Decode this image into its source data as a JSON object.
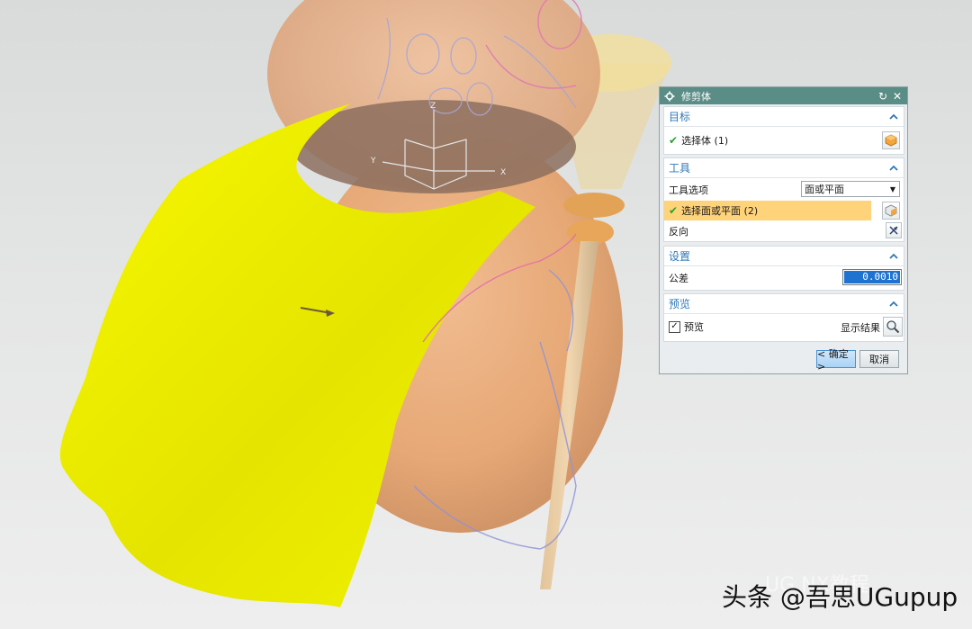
{
  "dialog": {
    "title": "修剪体",
    "target": {
      "header": "目标",
      "select_body": "选择体 (1)"
    },
    "tool": {
      "header": "工具",
      "tool_option_label": "工具选项",
      "tool_option_value": "面或平面",
      "select_face": "选择面或平面 (2)",
      "reverse_label": "反向"
    },
    "settings": {
      "header": "设置",
      "tolerance_label": "公差",
      "tolerance_value": "0.0010"
    },
    "preview": {
      "header": "预览",
      "preview_label": "预览",
      "preview_checked": true,
      "show_result_label": "显示结果"
    },
    "ok_label": "< 确定 >",
    "cancel_label": "取消"
  },
  "viewport": {
    "axis_labels": {
      "x": "X",
      "y": "Y",
      "z": "Z"
    }
  },
  "watermark": {
    "main": "头条 @吾思UGupup",
    "faint": "UG  NX教程"
  },
  "colors": {
    "titlebar": "#5b8d87",
    "section_header": "#2f78b8",
    "highlight_row": "#ffd37a",
    "yellow_surface": "#f5f500",
    "gourd": "#e9a46a"
  }
}
